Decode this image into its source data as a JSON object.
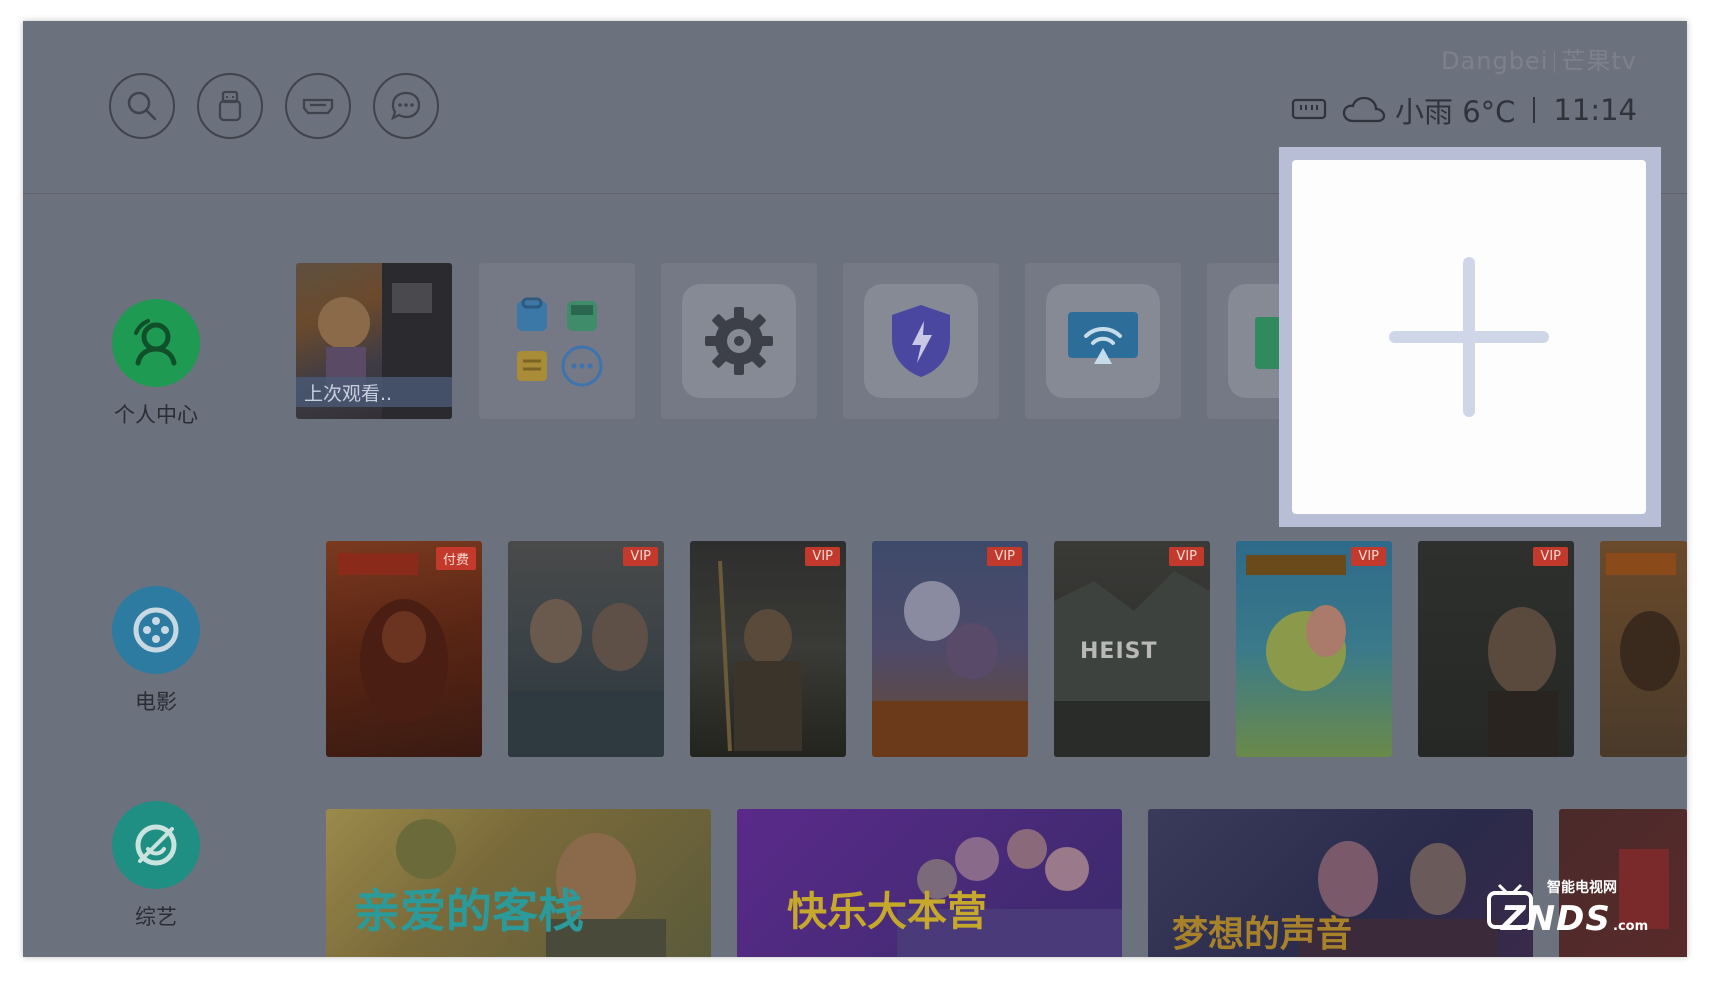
{
  "header": {
    "brand": "Dangbei",
    "brand_partner": "芒果tv",
    "weather": "小雨 6°C",
    "time": "11:14"
  },
  "toolbar": {
    "icons": [
      "search-icon",
      "usb-icon",
      "hdmi-icon",
      "message-icon"
    ]
  },
  "nav": {
    "items": [
      {
        "label": "个人中心",
        "icon": "user-icon",
        "color": "#1e9a52"
      },
      {
        "label": "电影",
        "icon": "film-reel-icon",
        "color": "#2d7ba1"
      },
      {
        "label": "综艺",
        "icon": "variety-icon",
        "color": "#1f8f84"
      }
    ]
  },
  "apps_row": {
    "continue_watch_label": "上次观看..",
    "apps": [
      "app-store-group-icon",
      "settings-icon",
      "security-shield-icon",
      "screen-cast-icon",
      "file-manager-icon"
    ],
    "add_card_icon": "plus-icon"
  },
  "movies": [
    {
      "badge": "付费"
    },
    {
      "badge": "VIP"
    },
    {
      "badge": "VIP"
    },
    {
      "badge": "VIP"
    },
    {
      "badge": "VIP",
      "title_text": "HEIST"
    },
    {
      "badge": "VIP"
    },
    {
      "badge": "VIP"
    },
    {
      "badge": ""
    }
  ],
  "variety_banners": [
    {
      "title": "亲爱的客栈"
    },
    {
      "title": "快乐大本营"
    },
    {
      "title": "梦想的声音"
    },
    {
      "title": ""
    }
  ],
  "watermark": {
    "line1": "智能电视网",
    "line2": "ZNDS",
    "suffix": ".com"
  },
  "colors": {
    "overlay_bg": "#6c717e",
    "add_card": "#fdfdfe",
    "add_card_frame": "#b7bed6",
    "plus": "#cfd6e8",
    "vip_badge": "#c33a2d"
  }
}
